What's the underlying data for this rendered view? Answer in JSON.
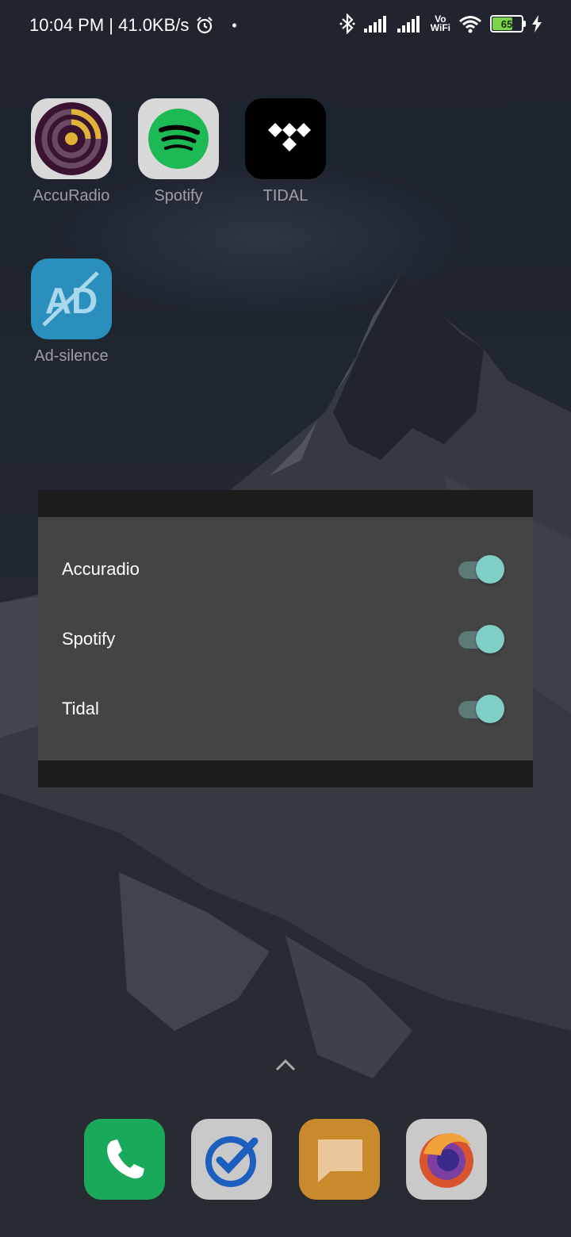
{
  "status_bar": {
    "time_speed": "10:04 PM | 41.0KB/s",
    "dot": "•",
    "vo": "Vo",
    "wifi_text": "WiFi",
    "battery": "65"
  },
  "home_apps": [
    {
      "label": "AccuRadio"
    },
    {
      "label": "Spotify"
    },
    {
      "label": "TIDAL"
    },
    {
      "label": "Ad-silence"
    }
  ],
  "adsilence_icon_text": "AD",
  "dialog": {
    "items": [
      {
        "label": "Accuradio",
        "enabled": true
      },
      {
        "label": "Spotify",
        "enabled": true
      },
      {
        "label": "Tidal",
        "enabled": true
      }
    ]
  },
  "dock": [
    "phone-icon",
    "tasks-icon",
    "messages-icon",
    "firefox-icon"
  ],
  "colors": {
    "switch_thumb": "#7fcfc7",
    "switch_track": "#5e7a78",
    "dialog_bg": "#444444"
  }
}
